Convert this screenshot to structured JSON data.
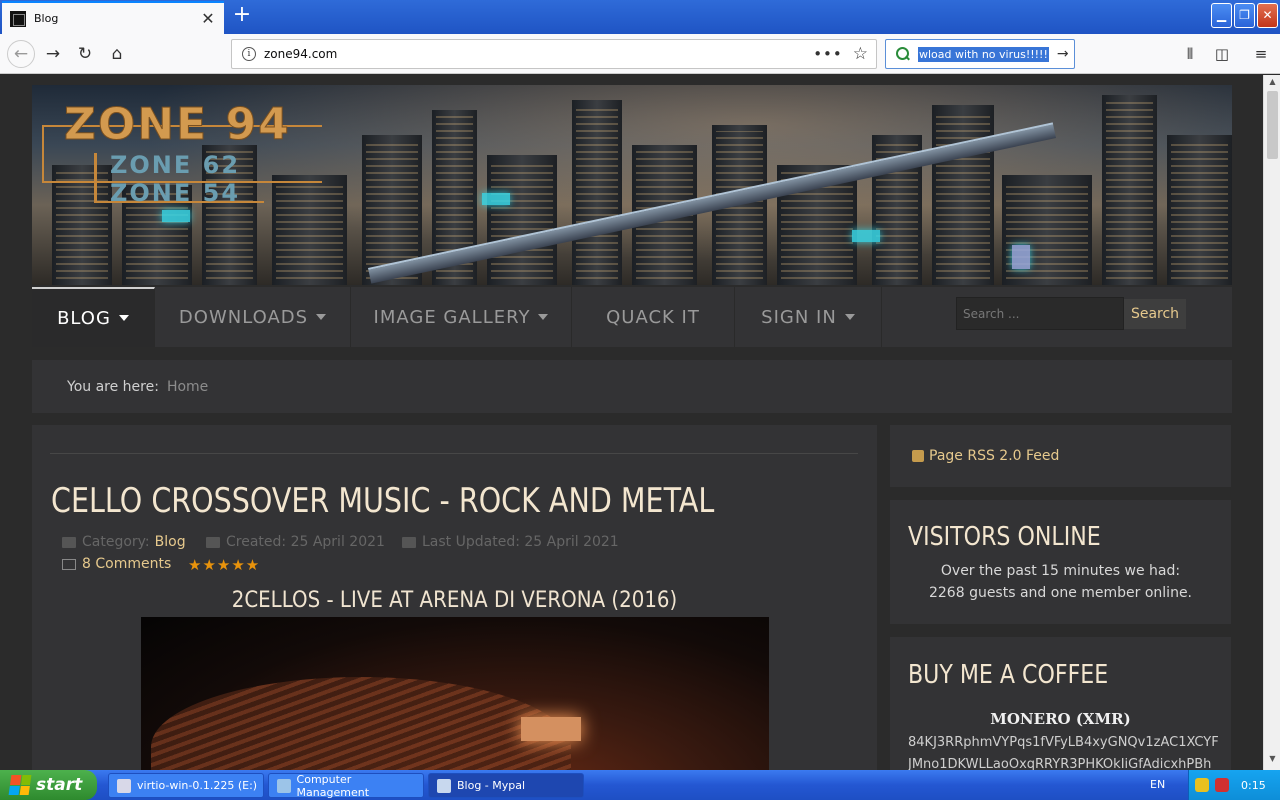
{
  "browser": {
    "tab_title": "Blog",
    "url": "zone94.com",
    "search_text": "wload with no virus!!!!!"
  },
  "site": {
    "logo_main": "ZONE 94",
    "logo_sub1": "ZONE 62",
    "logo_sub2": "ZONE 54",
    "menu": [
      {
        "label": "BLOG",
        "has_dropdown": true,
        "active": true
      },
      {
        "label": "DOWNLOADS",
        "has_dropdown": true
      },
      {
        "label": "IMAGE GALLERY",
        "has_dropdown": true
      },
      {
        "label": "QUACK IT",
        "has_dropdown": false
      },
      {
        "label": "SIGN IN",
        "has_dropdown": true
      }
    ],
    "search_placeholder": "Search ...",
    "search_button": "Search",
    "breadcrumb_label": "You are here:",
    "breadcrumb_home": "Home"
  },
  "article": {
    "title": "CELLO CROSSOVER MUSIC - ROCK AND METAL",
    "category_label": "Category:",
    "category": "Blog",
    "created": "Created: 25 April 2021",
    "updated": "Last Updated: 25 April 2021",
    "comments": "8 Comments",
    "rating_stars": 5,
    "video_title": "2CELLOS - LIVE AT ARENA DI VERONA (2016)"
  },
  "sidebar": {
    "rss": "Page RSS 2.0 Feed",
    "visitors_heading": "VISITORS ONLINE",
    "visitors_line1": "Over the past 15 minutes we had:",
    "visitors_line2": "2268 guests and one member online.",
    "coffee_heading": "BUY ME A COFFEE",
    "coin_title": "MONERO (XMR)",
    "address_line1": "84KJ3RRphmVYPqs1fVFyLB4xyGNQv1zAC1XCYF",
    "address_line2": "JMno1DKWLLaoOxqRRYR3PHKOkIiGfAdicxhPBh"
  },
  "taskbar": {
    "start": "start",
    "items": [
      {
        "label": "virtio-win-0.1.225 (E:)"
      },
      {
        "label": "Computer Management"
      },
      {
        "label": "Blog - Mypal"
      }
    ],
    "lang": "EN",
    "time": "0:15"
  }
}
